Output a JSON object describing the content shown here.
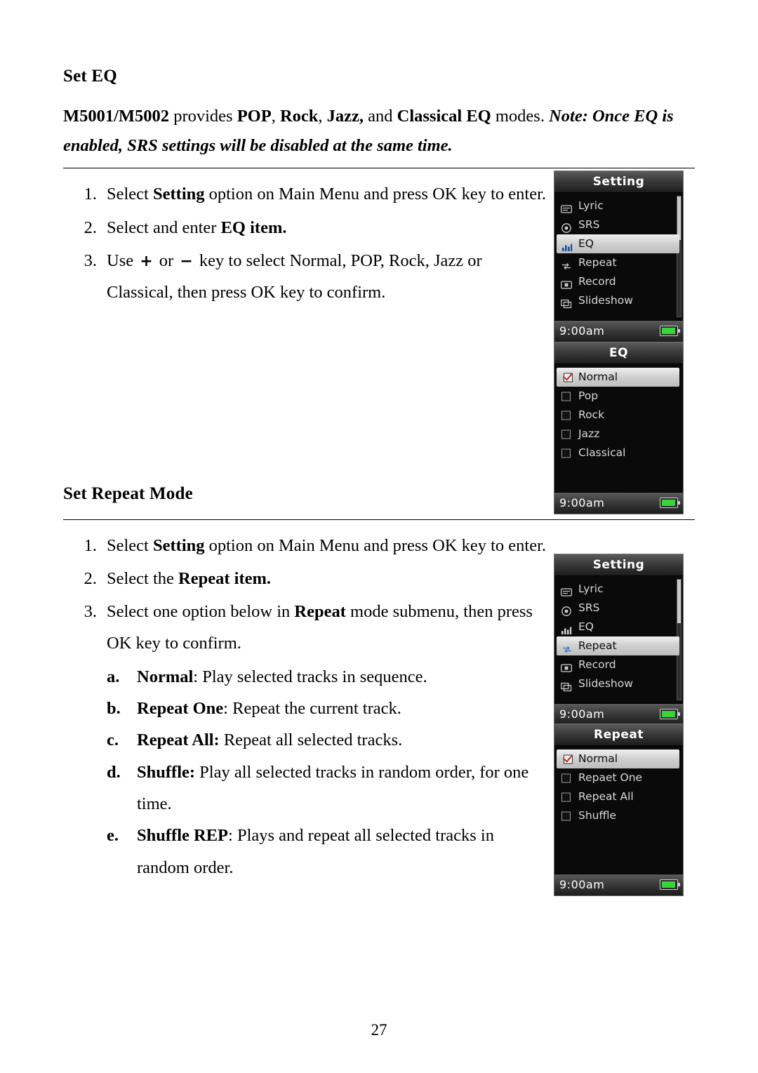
{
  "document": {
    "page_number": "27"
  },
  "section1": {
    "title": "Set EQ",
    "intro_parts": {
      "model": "M5001/M5002",
      "t1": " provides ",
      "pop": "POP",
      "t2": ", ",
      "rock": "Rock",
      "t3": ", ",
      "jazz": "Jazz,",
      "t4": " and ",
      "classical": "Classical EQ",
      "t5": " modes. ",
      "note": "Note: Once EQ is enabled, SRS settings will be disabled at the same time."
    },
    "steps": [
      {
        "num": "1.",
        "pre": "Select ",
        "bold": "Setting",
        "post": " option on Main Menu and press OK key to enter."
      },
      {
        "num": "2.",
        "pre": "Select and enter ",
        "bold": "EQ",
        "post": " item."
      },
      {
        "num": "3.",
        "pre": "Use ",
        "plus": "+",
        "mid": " or ",
        "minus": "−",
        "post": " key to select Normal, POP, Rock, Jazz or Classical, then press OK key to confirm."
      }
    ]
  },
  "section2": {
    "title": "Set Repeat Mode",
    "steps": [
      {
        "num": "1.",
        "pre": "Select ",
        "bold": "Setting",
        "post": " option on Main Menu and press OK key to enter."
      },
      {
        "num": "2.",
        "pre": "Select the ",
        "bold": "Repeat",
        "post": " item."
      },
      {
        "num": "3.",
        "pre": "Select one option below in ",
        "bold": "Repeat",
        "post": " mode submenu, then press OK key to confirm."
      }
    ],
    "substeps": [
      {
        "num": "a.",
        "bold": "Normal",
        "post": ": Play selected tracks in sequence."
      },
      {
        "num": "b.",
        "bold": "Repeat One",
        "post": ": Repeat the current track."
      },
      {
        "num": "c.",
        "bold": "Repeat All:",
        "post": " Repeat all selected tracks."
      },
      {
        "num": "d.",
        "bold": "Shuffle:",
        "post": " Play all selected tracks in random order, for one time."
      },
      {
        "num": "e.",
        "bold": "Shuffle REP",
        "post": ": Plays and repeat all selected tracks in random order."
      }
    ]
  },
  "screens": {
    "setting_eq": {
      "title": "Setting",
      "clock": "9:00am",
      "items": [
        {
          "label": "Lyric",
          "icon": "lyric-icon",
          "selected": false
        },
        {
          "label": "SRS",
          "icon": "srs-icon",
          "selected": false
        },
        {
          "label": "EQ",
          "icon": "eq-icon",
          "selected": true
        },
        {
          "label": "Repeat",
          "icon": "repeat-icon",
          "selected": false
        },
        {
          "label": "Record",
          "icon": "record-icon",
          "selected": false
        },
        {
          "label": "Slideshow",
          "icon": "slideshow-icon",
          "selected": false
        }
      ]
    },
    "eq": {
      "title": "EQ",
      "clock": "9:00am",
      "items": [
        {
          "label": "Normal",
          "checked": true,
          "selected": true
        },
        {
          "label": "Pop",
          "checked": false,
          "selected": false
        },
        {
          "label": "Rock",
          "checked": false,
          "selected": false
        },
        {
          "label": "Jazz",
          "checked": false,
          "selected": false
        },
        {
          "label": "Classical",
          "checked": false,
          "selected": false
        }
      ]
    },
    "setting_repeat": {
      "title": "Setting",
      "clock": "9:00am",
      "items": [
        {
          "label": "Lyric",
          "icon": "lyric-icon",
          "selected": false
        },
        {
          "label": "SRS",
          "icon": "srs-icon",
          "selected": false
        },
        {
          "label": "EQ",
          "icon": "eq-icon",
          "selected": false
        },
        {
          "label": "Repeat",
          "icon": "repeat-icon",
          "selected": true
        },
        {
          "label": "Record",
          "icon": "record-icon",
          "selected": false
        },
        {
          "label": "Slideshow",
          "icon": "slideshow-icon",
          "selected": false
        }
      ]
    },
    "repeat": {
      "title": "Repeat",
      "clock": "9:00am",
      "items": [
        {
          "label": "Normal",
          "checked": true,
          "selected": true
        },
        {
          "label": "Repaet One",
          "checked": false,
          "selected": false
        },
        {
          "label": "Repeat All",
          "checked": false,
          "selected": false
        },
        {
          "label": "Shuffle",
          "checked": false,
          "selected": false
        }
      ]
    }
  }
}
